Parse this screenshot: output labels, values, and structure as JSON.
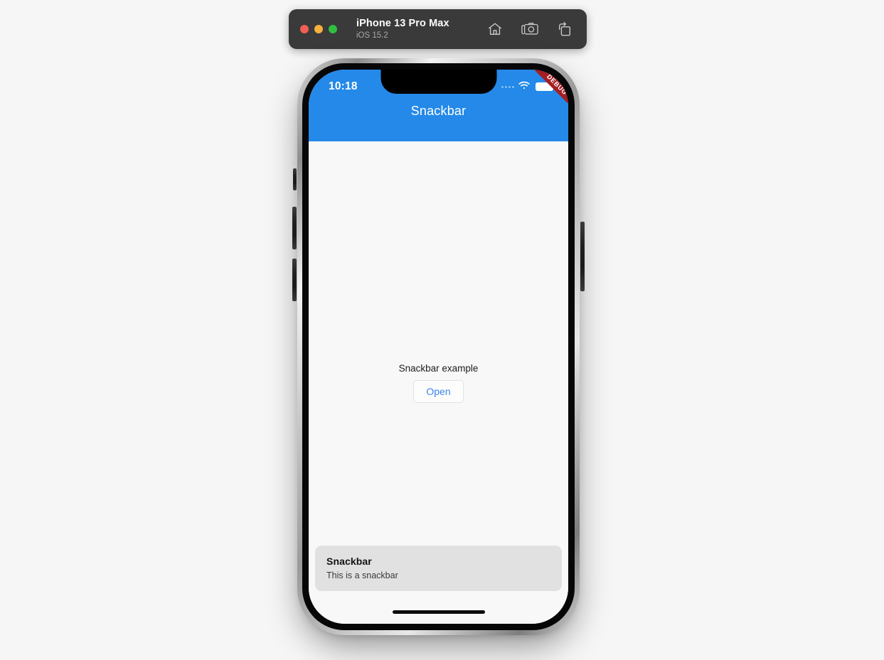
{
  "simulator": {
    "device_name": "iPhone 13 Pro Max",
    "os_version": "iOS 15.2",
    "window_controls": [
      {
        "name": "close",
        "color": "#f25d56"
      },
      {
        "name": "minimize",
        "color": "#f6b13d"
      },
      {
        "name": "zoom",
        "color": "#2fbe3f"
      }
    ],
    "actions": [
      {
        "icon": "home-icon",
        "label": "Home"
      },
      {
        "icon": "screenshot-camera-icon",
        "label": "Screenshot"
      },
      {
        "icon": "rotate-icon",
        "label": "Rotate"
      }
    ]
  },
  "status_bar": {
    "time": "10:18",
    "cellular_icon": "cellular-dots-icon",
    "wifi_icon": "wifi-icon",
    "battery_icon": "battery-icon"
  },
  "app_bar": {
    "title": "Snackbar",
    "background_color": "#2489e8",
    "title_color": "#ffffff"
  },
  "debug_banner": {
    "label": "DEBUG",
    "color": "#a61e22"
  },
  "content": {
    "label": "Snackbar example",
    "open_button_label": "Open",
    "open_button_color": "#3b85e8",
    "background_color": "#f8f8f8"
  },
  "snackbar": {
    "title": "Snackbar",
    "message": "This is a snackbar",
    "background_color": "#e1e1e1"
  }
}
